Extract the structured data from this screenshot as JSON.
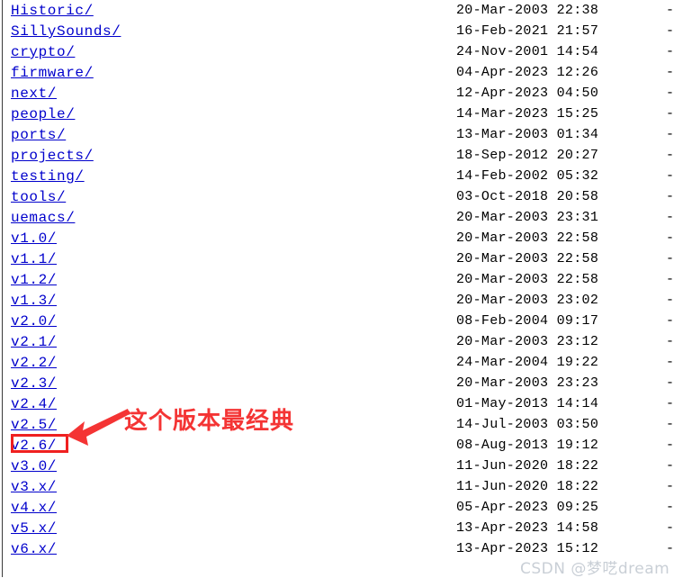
{
  "page": {
    "type": "apache-directory-index",
    "background_color": "#ffffff",
    "link_color": "#0000cc",
    "text_color": "#000000"
  },
  "listing": {
    "size_placeholder": "-",
    "rows": [
      {
        "name": "Historic/",
        "date": "20-Mar-2003 22:38",
        "size": "-"
      },
      {
        "name": "SillySounds/",
        "date": "16-Feb-2021 21:57",
        "size": "-"
      },
      {
        "name": "crypto/",
        "date": "24-Nov-2001 14:54",
        "size": "-"
      },
      {
        "name": "firmware/",
        "date": "04-Apr-2023 12:26",
        "size": "-"
      },
      {
        "name": "next/",
        "date": "12-Apr-2023 04:50",
        "size": "-"
      },
      {
        "name": "people/",
        "date": "14-Mar-2023 15:25",
        "size": "-"
      },
      {
        "name": "ports/",
        "date": "13-Mar-2003 01:34",
        "size": "-"
      },
      {
        "name": "projects/",
        "date": "18-Sep-2012 20:27",
        "size": "-"
      },
      {
        "name": "testing/",
        "date": "14-Feb-2002 05:32",
        "size": "-"
      },
      {
        "name": "tools/",
        "date": "03-Oct-2018 20:58",
        "size": "-"
      },
      {
        "name": "uemacs/",
        "date": "20-Mar-2003 23:31",
        "size": "-"
      },
      {
        "name": "v1.0/",
        "date": "20-Mar-2003 22:58",
        "size": "-"
      },
      {
        "name": "v1.1/",
        "date": "20-Mar-2003 22:58",
        "size": "-"
      },
      {
        "name": "v1.2/",
        "date": "20-Mar-2003 22:58",
        "size": "-"
      },
      {
        "name": "v1.3/",
        "date": "20-Mar-2003 23:02",
        "size": "-"
      },
      {
        "name": "v2.0/",
        "date": "08-Feb-2004 09:17",
        "size": "-"
      },
      {
        "name": "v2.1/",
        "date": "20-Mar-2003 23:12",
        "size": "-"
      },
      {
        "name": "v2.2/",
        "date": "24-Mar-2004 19:22",
        "size": "-"
      },
      {
        "name": "v2.3/",
        "date": "20-Mar-2003 23:23",
        "size": "-"
      },
      {
        "name": "v2.4/",
        "date": "01-May-2013 14:14",
        "size": "-"
      },
      {
        "name": "v2.5/",
        "date": "14-Jul-2003 03:50",
        "size": "-"
      },
      {
        "name": "v2.6/",
        "date": "08-Aug-2013 19:12",
        "size": "-"
      },
      {
        "name": "v3.0/",
        "date": "11-Jun-2020 18:22",
        "size": "-"
      },
      {
        "name": "v3.x/",
        "date": "11-Jun-2020 18:22",
        "size": "-"
      },
      {
        "name": "v4.x/",
        "date": "05-Apr-2023 09:25",
        "size": "-"
      },
      {
        "name": "v5.x/",
        "date": "13-Apr-2023 14:58",
        "size": "-"
      },
      {
        "name": "v6.x/",
        "date": "13-Apr-2023 15:12",
        "size": "-"
      }
    ]
  },
  "annotation": {
    "color": "#f43434",
    "text": "这个版本最经典",
    "highlight_target": "v2.6/",
    "arrow_icon": "arrow-left-icon"
  },
  "watermark": {
    "text": "CSDN @梦呓dream",
    "color": "#c9cfd6"
  }
}
